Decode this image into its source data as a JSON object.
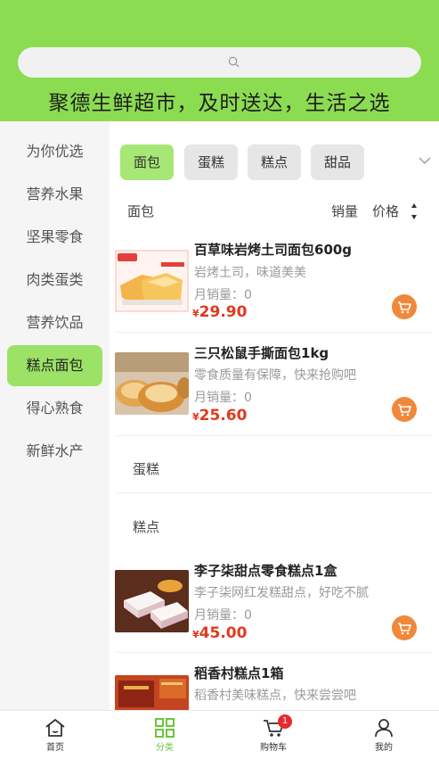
{
  "header": {
    "search": {
      "placeholder": ""
    },
    "slogan": "聚德生鲜超市，及时送达，生活之选"
  },
  "sidebar": {
    "items": [
      {
        "label": "为你优选"
      },
      {
        "label": "营养水果"
      },
      {
        "label": "坚果零食"
      },
      {
        "label": "肉类蛋类"
      },
      {
        "label": "营养饮品"
      },
      {
        "label": "糕点面包",
        "active": true
      },
      {
        "label": "得心熟食"
      },
      {
        "label": "新鲜水产"
      }
    ]
  },
  "tabs": [
    "面包",
    "蛋糕",
    "糕点",
    "甜品"
  ],
  "sort": {
    "category": "面包",
    "sales": "销量",
    "price": "价格"
  },
  "products": [
    {
      "name": "百草味岩烤土司面包600g",
      "desc": "岩烤土司，味道美美",
      "sales": "月销量：0",
      "currency": "¥",
      "price": "29.90"
    },
    {
      "name": "三只松鼠手撕面包1kg",
      "desc": "零食质量有保障，快来抢购吧",
      "sales": "月销量：0",
      "currency": "¥",
      "price": "25.60"
    },
    {
      "name": "李子柒甜点零食糕点1盒",
      "desc": "李子柒网红发糕甜点，好吃不腻",
      "sales": "月销量：0",
      "currency": "¥",
      "price": "45.00"
    },
    {
      "name": "稻香村糕点1箱",
      "desc": "稻香村美味糕点，快来尝尝吧"
    }
  ],
  "sections": {
    "cake": "蛋糕",
    "pastry": "糕点"
  },
  "bottom_nav": [
    {
      "label": "首页",
      "icon": "home-icon"
    },
    {
      "label": "分类",
      "icon": "grid-icon",
      "active": true
    },
    {
      "label": "购物车",
      "icon": "cart-icon",
      "badge": "1"
    },
    {
      "label": "我的",
      "icon": "user-icon"
    }
  ],
  "colors": {
    "brand": "#8cdc52",
    "active_tab": "#a7e775",
    "price": "#e03a1e",
    "cart": "#f0883a",
    "badge": "#e8292c"
  }
}
